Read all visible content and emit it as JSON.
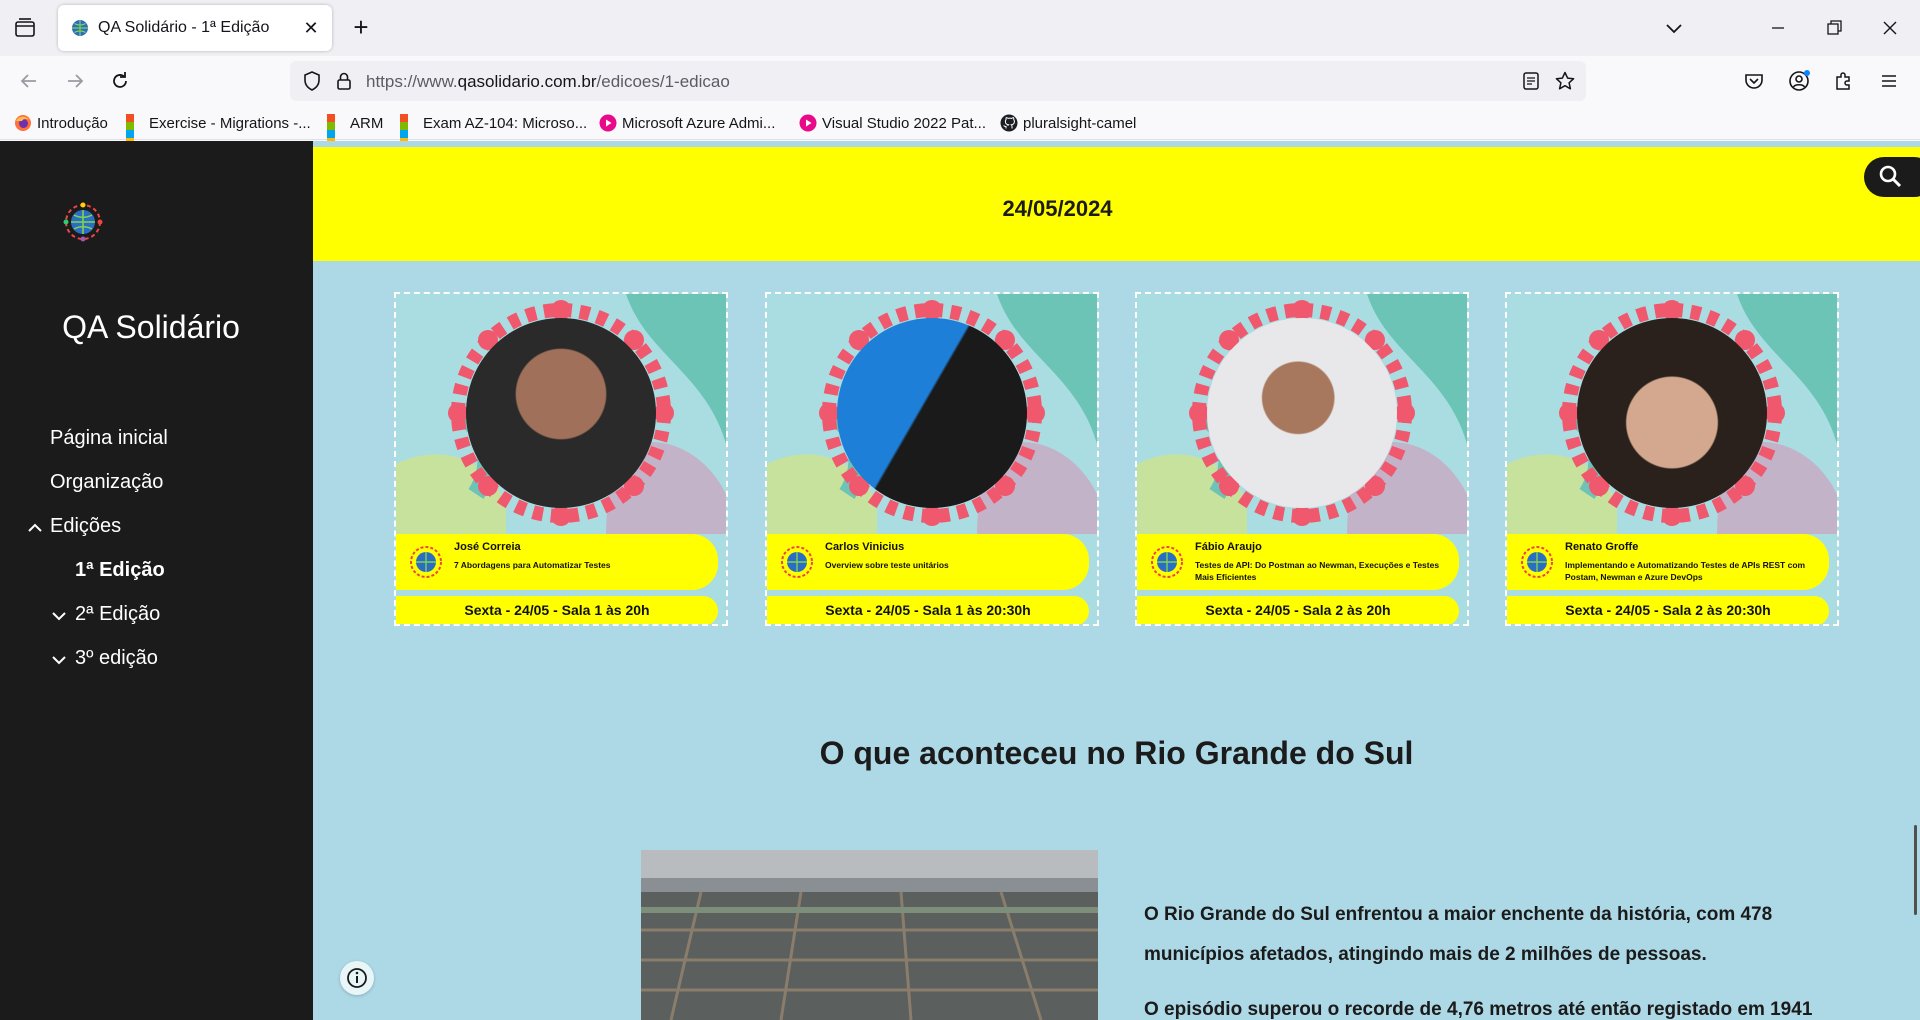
{
  "browser": {
    "tab_title": "QA Solidário - 1ª Edição",
    "tab_close": "✕",
    "new_tab": "+",
    "url_prefix": "https://www.",
    "url_host": "qasolidario.com.br",
    "url_path": "/edicoes/1-edicao",
    "bookmarks": [
      {
        "label": "Introdução",
        "icon": "firefox-icon"
      },
      {
        "label": "Exercise - Migrations -...",
        "icon": "microsoft-icon"
      },
      {
        "label": "ARM",
        "icon": "microsoft-icon"
      },
      {
        "label": "Exam AZ-104: Microso...",
        "icon": "microsoft-icon"
      },
      {
        "label": "Microsoft Azure Admi...",
        "icon": "pluralsight-icon"
      },
      {
        "label": "Visual Studio 2022 Pat...",
        "icon": "pluralsight-icon"
      },
      {
        "label": "pluralsight-camel",
        "icon": "github-icon"
      }
    ]
  },
  "sidebar": {
    "site_title": "QA Solidário",
    "menu": [
      {
        "label": "Página inicial"
      },
      {
        "label": "Organização"
      },
      {
        "label": "Edições",
        "expanded": true
      },
      {
        "label": "1ª Edição",
        "active": true
      },
      {
        "label": "2ª Edição",
        "expanded": false
      },
      {
        "label": "3º edição",
        "expanded": false
      }
    ]
  },
  "main": {
    "date": "24/05/2024",
    "talks": [
      {
        "speaker": "José Correia",
        "title": "7 Abordagens para Automatizar Testes",
        "when": "Sexta - 24/05 - Sala 1 às 20h"
      },
      {
        "speaker": "Carlos Vinicius",
        "title": "Overview sobre teste unitários",
        "when": "Sexta - 24/05 - Sala 1 às 20:30h"
      },
      {
        "speaker": "Fábio Araujo",
        "title": "Testes de API: Do Postman ao Newman, Execuções e Testes Mais Eficientes",
        "when": "Sexta - 24/05 - Sala 2 às 20h"
      },
      {
        "speaker": "Renato Groffe",
        "title": "Implementando e Automatizando Testes de APIs REST com Postam, Newman e Azure DevOps",
        "when": "Sexta - 24/05 - Sala 2 às 20:30h"
      }
    ],
    "section_title": "O que aconteceu no Rio Grande do Sul",
    "paragraphs": [
      "O Rio Grande do Sul enfrentou a maior enchente da história, com 478",
      "municípios afetados, atingindo mais de 2 milhões de pessoas.",
      "O episódio superou o recorde de 4,76 metros até então registado em 1941"
    ]
  },
  "colors": {
    "sidebar_bg": "#1b1b1b",
    "page_bg": "#add8e6",
    "highlight_yellow": "#ffff00",
    "flower_pink": "#f0586e"
  }
}
